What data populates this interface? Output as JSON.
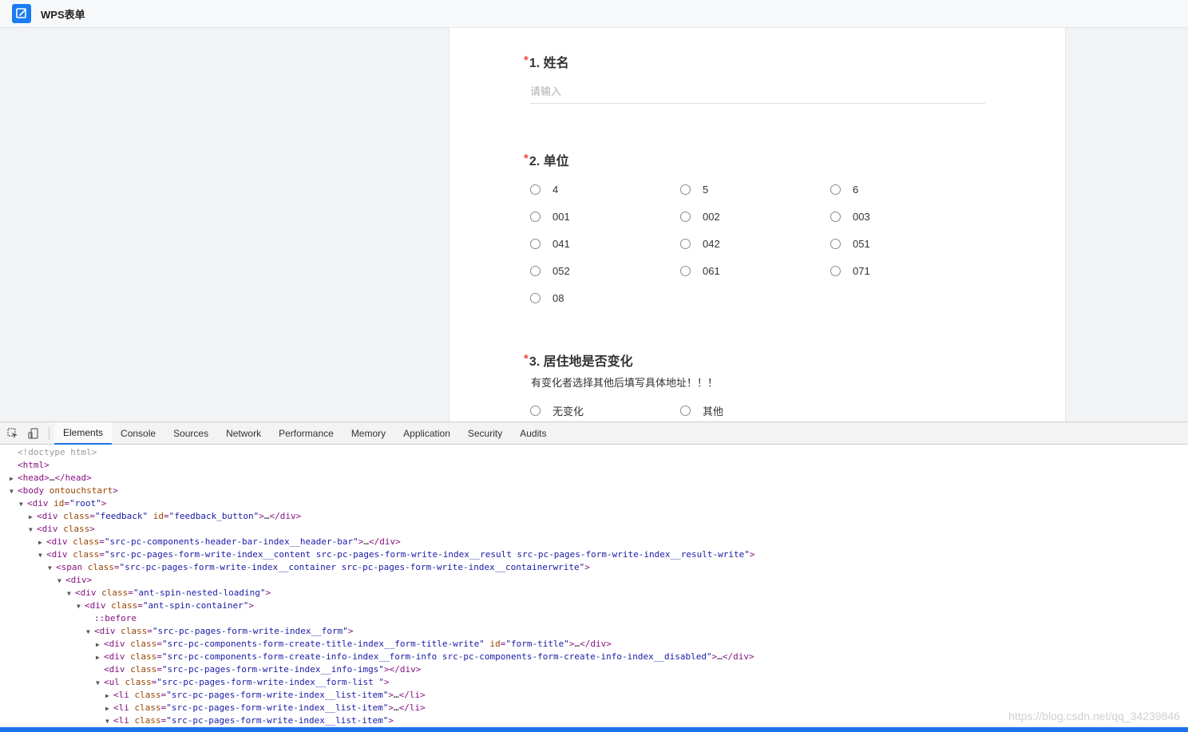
{
  "header": {
    "title": "WPS表单",
    "logo_icon": "form-edit-icon"
  },
  "form": {
    "q1": {
      "required": "*",
      "title": "1. 姓名",
      "placeholder": "请输入"
    },
    "q2": {
      "required": "*",
      "title": "2. 单位",
      "options": [
        "4",
        "5",
        "6",
        "001",
        "002",
        "003",
        "041",
        "042",
        "051",
        "052",
        "061",
        "071",
        "08"
      ]
    },
    "q3": {
      "required": "*",
      "title": "3. 居住地是否变化",
      "description": "有变化者选择其他后填写具体地址！！！",
      "options": [
        "无变化",
        "其他"
      ]
    }
  },
  "devtools": {
    "tabs": [
      "Elements",
      "Console",
      "Sources",
      "Network",
      "Performance",
      "Memory",
      "Application",
      "Security",
      "Audits"
    ],
    "active_tab": "Elements",
    "accent_color": "#1a73e8"
  },
  "dom_tree": [
    {
      "tri": "",
      "indent": 0,
      "text": "<!doctype html>"
    },
    {
      "tri": "",
      "indent": 0,
      "text": "<html>"
    },
    {
      "tri": "▶",
      "indent": 0,
      "text": "<head>…</head>"
    },
    {
      "tri": "▼",
      "indent": 0,
      "text": "<body ontouchstart>"
    },
    {
      "tri": "▼",
      "indent": 1,
      "text": "<div id=\"root\">"
    },
    {
      "tri": "▶",
      "indent": 2,
      "text": "<div class=\"feedback\" id=\"feedback_button\">…</div>"
    },
    {
      "tri": "▼",
      "indent": 2,
      "text": "<div class>"
    },
    {
      "tri": "▶",
      "indent": 3,
      "text": "<div class=\"src-pc-components-header-bar-index__header-bar\">…</div>"
    },
    {
      "tri": "▼",
      "indent": 3,
      "text": "<div class=\"src-pc-pages-form-write-index__content src-pc-pages-form-write-index__result src-pc-pages-form-write-index__result-write\">"
    },
    {
      "tri": "▼",
      "indent": 4,
      "text": "<span class=\"src-pc-pages-form-write-index__container src-pc-pages-form-write-index__containerwrite\">"
    },
    {
      "tri": "▼",
      "indent": 5,
      "text": "<div>"
    },
    {
      "tri": "▼",
      "indent": 6,
      "text": "<div class=\"ant-spin-nested-loading\">"
    },
    {
      "tri": "▼",
      "indent": 7,
      "text": "<div class=\"ant-spin-container\">"
    },
    {
      "tri": "",
      "indent": 8,
      "text": "::before"
    },
    {
      "tri": "▼",
      "indent": 8,
      "text": "<div class=\"src-pc-pages-form-write-index__form\">"
    },
    {
      "tri": "▶",
      "indent": 9,
      "text": "<div class=\"src-pc-components-form-create-title-index__form-title-write\" id=\"form-title\">…</div>"
    },
    {
      "tri": "▶",
      "indent": 9,
      "text": "<div class=\"src-pc-components-form-create-info-index__form-info src-pc-components-form-create-info-index__disabled\">…</div>"
    },
    {
      "tri": "",
      "indent": 9,
      "text": "<div class=\"src-pc-pages-form-write-index__info-imgs\"></div>"
    },
    {
      "tri": "▼",
      "indent": 9,
      "text": "<ul class=\"src-pc-pages-form-write-index__form-list \">"
    },
    {
      "tri": "▶",
      "indent": 10,
      "text": "<li class=\"src-pc-pages-form-write-index__list-item\">…</li>"
    },
    {
      "tri": "▶",
      "indent": 10,
      "text": "<li class=\"src-pc-pages-form-write-index__list-item\">…</li>"
    },
    {
      "tri": "▼",
      "indent": 10,
      "text": "<li class=\"src-pc-pages-form-write-index__list-item\">"
    }
  ],
  "watermark": "https://blog.csdn.net/qq_34239846"
}
